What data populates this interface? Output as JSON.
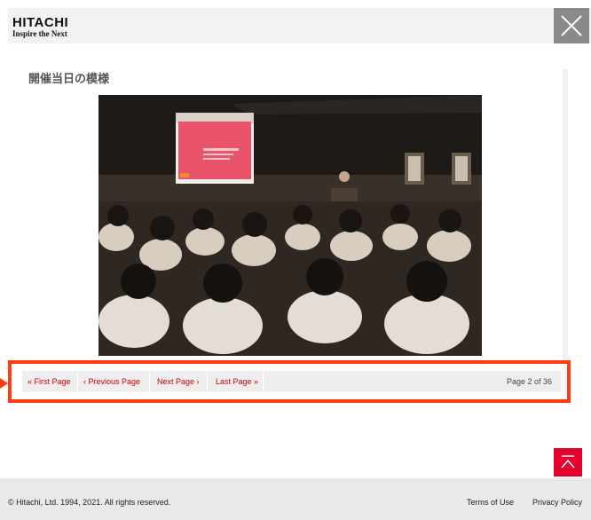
{
  "header": {
    "logo_main": "HITACHI",
    "logo_tagline": "Inspire the Next",
    "close_icon": "close-icon"
  },
  "content": {
    "title": "開催当日の模様",
    "photo_icon": "event-photo"
  },
  "pager": {
    "first_label": "« First Page",
    "previous_label": "‹ Previous Page",
    "next_label": "Next Page ›",
    "last_label": "Last Page »",
    "page_count": "Page 2 of 36"
  },
  "back_to_top": {
    "icon": "chevron-up-icon"
  },
  "footer": {
    "copyright": "© Hitachi, Ltd. 1994, 2021. All rights reserved.",
    "terms_label": "Terms of Use",
    "privacy_label": "Privacy Policy"
  },
  "colors": {
    "accent": "#cc0000",
    "highlight": "#ff3b14",
    "back_to_top_bg": "#e6002d"
  }
}
